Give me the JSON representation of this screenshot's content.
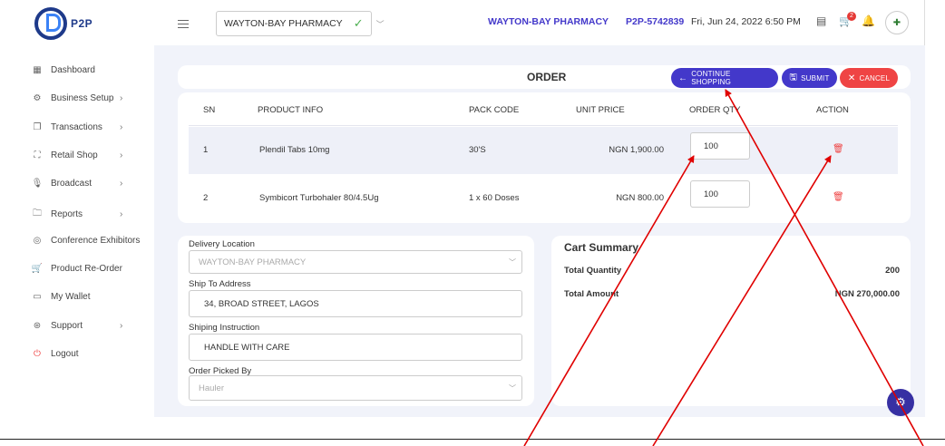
{
  "brand": {
    "logo_text": "P2P"
  },
  "header": {
    "store_select": {
      "value": "WAYTON-BAY PHARMACY"
    },
    "store_name": "WAYTON-BAY PHARMACY",
    "account_code": "P2P-5742839",
    "datetime": "Fri, Jun 24, 2022 6:50 PM",
    "cart_count": "2"
  },
  "sidebar": {
    "items": [
      {
        "label": "Dashboard",
        "icon": "grid-icon",
        "has_children": false
      },
      {
        "label": "Business Setup",
        "icon": "gear-icon",
        "has_children": true
      },
      {
        "label": "Transactions",
        "icon": "copy-icon",
        "has_children": true
      },
      {
        "label": "Retail Shop",
        "icon": "frame-icon",
        "has_children": true
      },
      {
        "label": "Broadcast",
        "icon": "mic-icon",
        "has_children": true
      },
      {
        "label": "Reports",
        "icon": "folder-icon",
        "has_children": true
      },
      {
        "label": "Conference Exhibitors",
        "icon": "target-icon",
        "has_children": false
      },
      {
        "label": "Product Re-Order",
        "icon": "cart-icon",
        "has_children": false
      },
      {
        "label": "My Wallet",
        "icon": "wallet-icon",
        "has_children": false
      },
      {
        "label": "Support",
        "icon": "lifebuoy-icon",
        "has_children": true
      },
      {
        "label": "Logout",
        "icon": "power-icon",
        "has_children": false
      }
    ]
  },
  "order": {
    "title": "ORDER",
    "buttons": {
      "continue": "CONTINUE SHOPPING",
      "submit": "SUBMIT",
      "cancel": "CANCEL"
    },
    "columns": [
      "SN",
      "PRODUCT INFO",
      "PACK CODE",
      "UNIT PRICE",
      "ORDER QTY",
      "ACTION"
    ],
    "rows": [
      {
        "sn": "1",
        "product": "Plendil Tabs 10mg",
        "pack": "30'S",
        "price": "NGN 1,900.00",
        "qty": "100"
      },
      {
        "sn": "2",
        "product": "Symbicort Turbohaler 80/4.5Ug",
        "pack": "1 x 60 Doses",
        "price": "NGN 800.00",
        "qty": "100"
      }
    ]
  },
  "delivery": {
    "location_label": "Delivery Location",
    "location_value": "WAYTON-BAY PHARMACY",
    "address_label": "Ship To Address",
    "address_value": "34, BROAD STREET, LAGOS",
    "instruction_label": "Shiping Instruction",
    "instruction_value": "HANDLE WITH CARE",
    "picked_label": "Order Picked By",
    "picked_value": "Hauler"
  },
  "cart_summary": {
    "title": "Cart Summary",
    "total_quantity_label": "Total Quantity",
    "total_quantity_value": "200",
    "total_amount_label": "Total Amount",
    "total_amount_value": "NGN 270,000.00"
  },
  "colors": {
    "primary": "#4338ca",
    "danger": "#ef4444",
    "success": "#4caf50",
    "background": "#f1f3fa",
    "annotation": "#e00000"
  }
}
